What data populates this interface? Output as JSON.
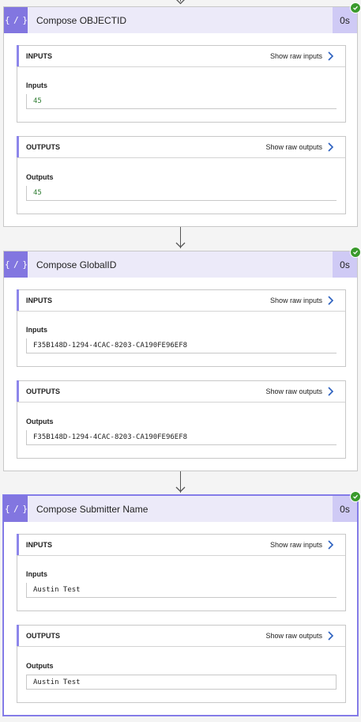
{
  "cards": [
    {
      "title": "Compose OBJECTID",
      "duration": "0s",
      "inputs_header": "INPUTS",
      "show_raw_inputs": "Show raw inputs",
      "inputs_label": "Inputs",
      "inputs_value": "45",
      "outputs_header": "OUTPUTS",
      "show_raw_outputs": "Show raw outputs",
      "outputs_label": "Outputs",
      "outputs_value": "45"
    },
    {
      "title": "Compose GlobalID",
      "duration": "0s",
      "inputs_header": "INPUTS",
      "show_raw_inputs": "Show raw inputs",
      "inputs_label": "Inputs",
      "inputs_value": "F35B148D-1294-4CAC-8203-CA190FE96EF8",
      "outputs_header": "OUTPUTS",
      "show_raw_outputs": "Show raw outputs",
      "outputs_label": "Outputs",
      "outputs_value": "F35B148D-1294-4CAC-8203-CA190FE96EF8"
    },
    {
      "title": "Compose Submitter Name",
      "duration": "0s",
      "inputs_header": "INPUTS",
      "show_raw_inputs": "Show raw inputs",
      "inputs_label": "Inputs",
      "inputs_value": "Austin Test",
      "outputs_header": "OUTPUTS",
      "show_raw_outputs": "Show raw outputs",
      "outputs_label": "Outputs",
      "outputs_value": "Austin Test"
    }
  ],
  "icons": {
    "card_icon": "compose-curly-braces-icon",
    "badge": "success-check-icon",
    "link_chevron": "chevron-right-icon",
    "connector": "arrow-down-icon"
  },
  "colors": {
    "accent": "#8276e0",
    "header_bg": "#eceaf9",
    "success": "#3a9a2c",
    "link_chevron": "#2a5fbf",
    "number_value": "#2f7d32"
  }
}
